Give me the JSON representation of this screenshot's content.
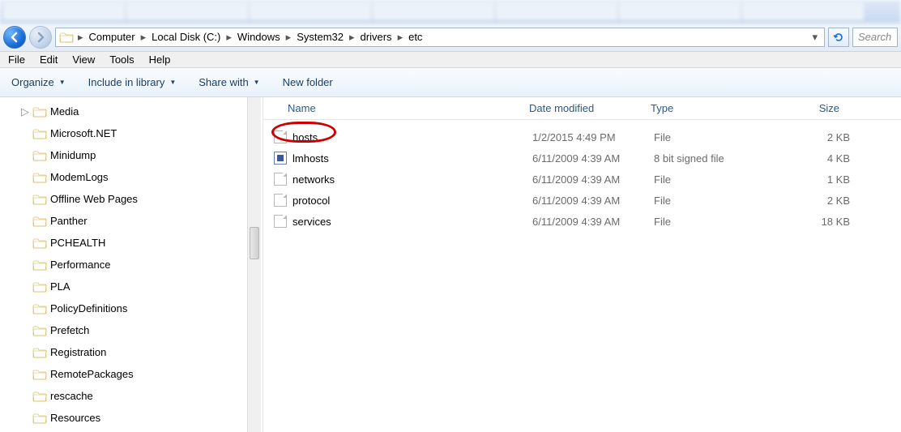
{
  "breadcrumb": [
    "Computer",
    "Local Disk (C:)",
    "Windows",
    "System32",
    "drivers",
    "etc"
  ],
  "search_placeholder": "Search",
  "menus": [
    "File",
    "Edit",
    "View",
    "Tools",
    "Help"
  ],
  "toolbar": {
    "organize": "Organize",
    "include": "Include in library",
    "share": "Share with",
    "new_folder": "New folder"
  },
  "tree": [
    {
      "name": "Media",
      "arrow": true
    },
    {
      "name": "Microsoft.NET"
    },
    {
      "name": "Minidump"
    },
    {
      "name": "ModemLogs"
    },
    {
      "name": "Offline Web Pages"
    },
    {
      "name": "Panther"
    },
    {
      "name": "PCHEALTH"
    },
    {
      "name": "Performance"
    },
    {
      "name": "PLA"
    },
    {
      "name": "PolicyDefinitions"
    },
    {
      "name": "Prefetch"
    },
    {
      "name": "Registration"
    },
    {
      "name": "RemotePackages"
    },
    {
      "name": "rescache"
    },
    {
      "name": "Resources"
    }
  ],
  "columns": {
    "name": "Name",
    "date": "Date modified",
    "type": "Type",
    "size": "Size"
  },
  "files": [
    {
      "name": "hosts",
      "date": "1/2/2015 4:49 PM",
      "type": "File",
      "size": "2 KB",
      "icon": "blank",
      "highlighted": true
    },
    {
      "name": "lmhosts",
      "date": "6/11/2009 4:39 AM",
      "type": "8 bit signed file",
      "size": "4 KB",
      "icon": "sys"
    },
    {
      "name": "networks",
      "date": "6/11/2009 4:39 AM",
      "type": "File",
      "size": "1 KB",
      "icon": "blank"
    },
    {
      "name": "protocol",
      "date": "6/11/2009 4:39 AM",
      "type": "File",
      "size": "2 KB",
      "icon": "blank"
    },
    {
      "name": "services",
      "date": "6/11/2009 4:39 AM",
      "type": "File",
      "size": "18 KB",
      "icon": "blank"
    }
  ]
}
